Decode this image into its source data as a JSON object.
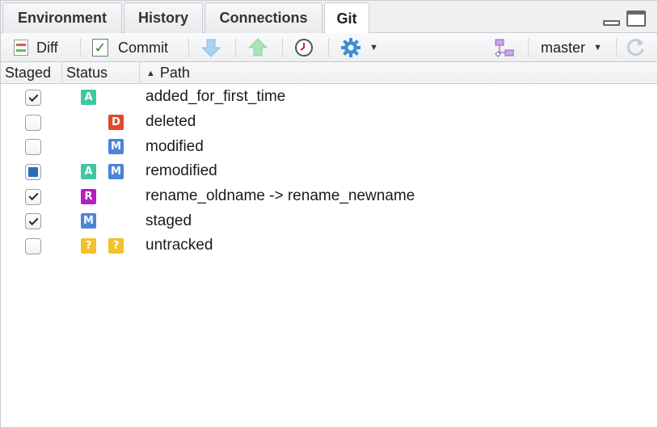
{
  "tabs": [
    {
      "label": "Environment"
    },
    {
      "label": "History"
    },
    {
      "label": "Connections"
    },
    {
      "label": "Git"
    }
  ],
  "active_tab": "Git",
  "toolbar": {
    "diff_label": "Diff",
    "commit_label": "Commit",
    "branch": "master",
    "icons": [
      "diff-icon",
      "commit-icon",
      "pull-icon",
      "push-icon",
      "history-icon",
      "gear-icon",
      "branch-icon",
      "refresh-icon"
    ]
  },
  "table": {
    "headers": {
      "staged": "Staged",
      "status": "Status",
      "path": "Path"
    },
    "sort": "path-ascending",
    "rows": [
      {
        "staged": "checked",
        "status1": "A",
        "status2": "",
        "path": "added_for_first_time"
      },
      {
        "staged": "unchecked",
        "status1": "",
        "status2": "D",
        "path": "deleted"
      },
      {
        "staged": "unchecked",
        "status1": "",
        "status2": "M",
        "path": "modified"
      },
      {
        "staged": "partial",
        "status1": "A",
        "status2": "M",
        "path": "remodified"
      },
      {
        "staged": "checked",
        "status1": "R",
        "status2": "",
        "path": "rename_oldname -> rename_newname"
      },
      {
        "staged": "checked",
        "status1": "M",
        "status2": "",
        "path": "staged"
      },
      {
        "staged": "unchecked",
        "status1": "?",
        "status2": "?",
        "path": "untracked"
      }
    ]
  },
  "status_colors": {
    "A": "#3fc8a0",
    "D": "#e0492e",
    "M": "#4a85d8",
    "R": "#b51ec4",
    "?": "#f3c22a"
  }
}
